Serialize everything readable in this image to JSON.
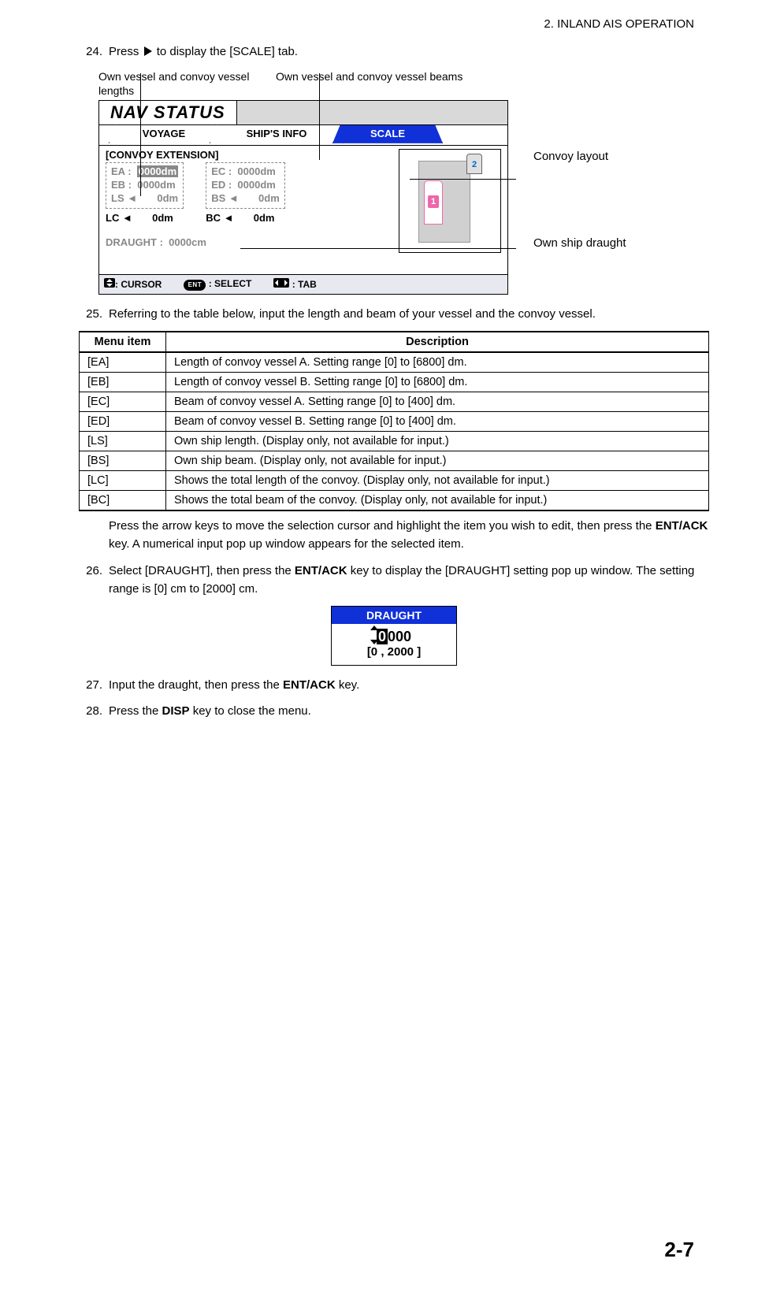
{
  "header": {
    "section": "2.  INLAND AIS OPERATION"
  },
  "steps": {
    "s24": {
      "num": "24.",
      "text_a": "Press ",
      "text_b": " to display the [SCALE] tab."
    },
    "s25": {
      "num": "25.",
      "text": "Referring to the table below, input the length and beam of your vessel and the convoy vessel."
    },
    "s26": {
      "num": "26.",
      "text_a": "Select [DRAUGHT], then press the ",
      "key1": "ENT/ACK",
      "text_b": " key to display the [DRAUGHT] setting pop up window. The setting range is [0] cm to [2000] cm."
    },
    "s27": {
      "num": "27.",
      "text_a": "Input the draught, then press the ",
      "key1": "ENT/ACK",
      "text_b": " key."
    },
    "s28": {
      "num": "28.",
      "text_a": "Press the ",
      "key1": "DISP",
      "text_b": " key to close the menu."
    }
  },
  "callouts": {
    "lengths": "Own vessel and convoy vessel lengths",
    "beams": "Own vessel and convoy vessel beams",
    "convoy_layout": "Convoy layout",
    "own_draught": "Own ship draught"
  },
  "lcd": {
    "title": "NAV STATUS",
    "tabs": {
      "t1": "VOYAGE",
      "t2": "SHIP'S   INFO",
      "t3": "SCALE"
    },
    "section": "[CONVOY EXTENSION]",
    "left": {
      "ea": "EA   :",
      "ea_v": "0000dm",
      "eb": "EB   :",
      "eb_v": "0000dm",
      "ls": "LS  ◄",
      "ls_v": "0dm",
      "lc": "LC  ◄",
      "lc_v": "0dm"
    },
    "right": {
      "ec": "EC   :",
      "ec_v": "0000dm",
      "ed": "ED   :",
      "ed_v": "0000dm",
      "bs": "BS  ◄",
      "bs_v": "0dm",
      "bc": "BC  ◄",
      "bc_v": "0dm"
    },
    "draught": "DRAUGHT   :",
    "draught_v": "0000cm",
    "vessel2": "2",
    "vessel1": "1",
    "footer": {
      "cursor": ": CURSOR",
      "ent": "ENT",
      "select": ": SELECT",
      "tab": ": TAB"
    }
  },
  "table": {
    "h1": "Menu item",
    "h2": "Description",
    "rows": [
      {
        "m": "[EA]",
        "d": "Length of convoy vessel A. Setting range [0] to [6800] dm."
      },
      {
        "m": "[EB]",
        "d": "Length of convoy vessel B. Setting range [0] to [6800] dm."
      },
      {
        "m": "[EC]",
        "d": "Beam of convoy vessel A. Setting range [0] to [400] dm."
      },
      {
        "m": "[ED]",
        "d": "Beam of convoy vessel B. Setting range [0] to [400] dm."
      },
      {
        "m": "[LS]",
        "d": "Own ship length. (Display only, not available for input.)"
      },
      {
        "m": "[BS]",
        "d": "Own ship beam. (Display only, not available for input.)"
      },
      {
        "m": "[LC]",
        "d": "Shows the total length of the convoy. (Display only, not available for input.)"
      },
      {
        "m": "[BC]",
        "d": "Shows the total beam of the convoy. (Display only, not available for input.)"
      }
    ]
  },
  "post_table": {
    "text_a": "Press the arrow keys to move the selection cursor and highlight the item you wish to edit, then press the ",
    "key1": "ENT/ACK",
    "text_b": " key. A numerical input pop up window appears for the selected item."
  },
  "popup": {
    "title": "DRAUGHT",
    "digit_hl": "0",
    "digits_rest": "000",
    "range": "[0 ,  2000 ]"
  },
  "page_num": "2-7"
}
